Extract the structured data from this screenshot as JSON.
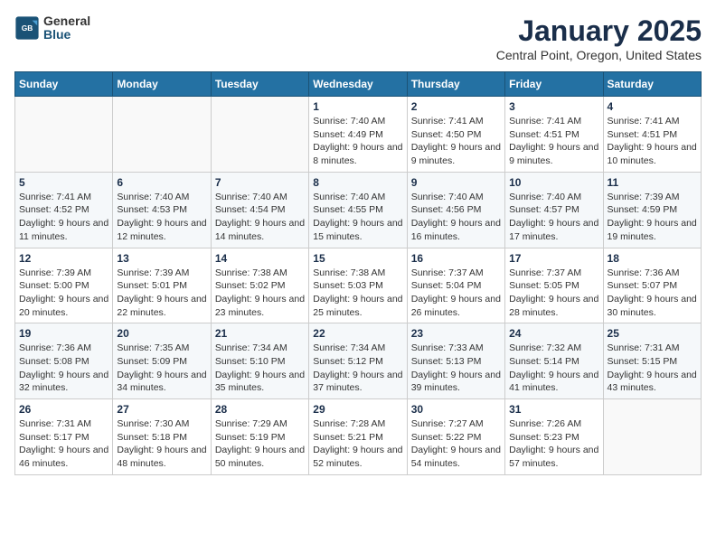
{
  "logo": {
    "general": "General",
    "blue": "Blue"
  },
  "title": "January 2025",
  "subtitle": "Central Point, Oregon, United States",
  "days_header": [
    "Sunday",
    "Monday",
    "Tuesday",
    "Wednesday",
    "Thursday",
    "Friday",
    "Saturday"
  ],
  "weeks": [
    [
      {
        "day": "",
        "info": ""
      },
      {
        "day": "",
        "info": ""
      },
      {
        "day": "",
        "info": ""
      },
      {
        "day": "1",
        "info": "Sunrise: 7:40 AM\nSunset: 4:49 PM\nDaylight: 9 hours and 8 minutes."
      },
      {
        "day": "2",
        "info": "Sunrise: 7:41 AM\nSunset: 4:50 PM\nDaylight: 9 hours and 9 minutes."
      },
      {
        "day": "3",
        "info": "Sunrise: 7:41 AM\nSunset: 4:51 PM\nDaylight: 9 hours and 9 minutes."
      },
      {
        "day": "4",
        "info": "Sunrise: 7:41 AM\nSunset: 4:51 PM\nDaylight: 9 hours and 10 minutes."
      }
    ],
    [
      {
        "day": "5",
        "info": "Sunrise: 7:41 AM\nSunset: 4:52 PM\nDaylight: 9 hours and 11 minutes."
      },
      {
        "day": "6",
        "info": "Sunrise: 7:40 AM\nSunset: 4:53 PM\nDaylight: 9 hours and 12 minutes."
      },
      {
        "day": "7",
        "info": "Sunrise: 7:40 AM\nSunset: 4:54 PM\nDaylight: 9 hours and 14 minutes."
      },
      {
        "day": "8",
        "info": "Sunrise: 7:40 AM\nSunset: 4:55 PM\nDaylight: 9 hours and 15 minutes."
      },
      {
        "day": "9",
        "info": "Sunrise: 7:40 AM\nSunset: 4:56 PM\nDaylight: 9 hours and 16 minutes."
      },
      {
        "day": "10",
        "info": "Sunrise: 7:40 AM\nSunset: 4:57 PM\nDaylight: 9 hours and 17 minutes."
      },
      {
        "day": "11",
        "info": "Sunrise: 7:39 AM\nSunset: 4:59 PM\nDaylight: 9 hours and 19 minutes."
      }
    ],
    [
      {
        "day": "12",
        "info": "Sunrise: 7:39 AM\nSunset: 5:00 PM\nDaylight: 9 hours and 20 minutes."
      },
      {
        "day": "13",
        "info": "Sunrise: 7:39 AM\nSunset: 5:01 PM\nDaylight: 9 hours and 22 minutes."
      },
      {
        "day": "14",
        "info": "Sunrise: 7:38 AM\nSunset: 5:02 PM\nDaylight: 9 hours and 23 minutes."
      },
      {
        "day": "15",
        "info": "Sunrise: 7:38 AM\nSunset: 5:03 PM\nDaylight: 9 hours and 25 minutes."
      },
      {
        "day": "16",
        "info": "Sunrise: 7:37 AM\nSunset: 5:04 PM\nDaylight: 9 hours and 26 minutes."
      },
      {
        "day": "17",
        "info": "Sunrise: 7:37 AM\nSunset: 5:05 PM\nDaylight: 9 hours and 28 minutes."
      },
      {
        "day": "18",
        "info": "Sunrise: 7:36 AM\nSunset: 5:07 PM\nDaylight: 9 hours and 30 minutes."
      }
    ],
    [
      {
        "day": "19",
        "info": "Sunrise: 7:36 AM\nSunset: 5:08 PM\nDaylight: 9 hours and 32 minutes."
      },
      {
        "day": "20",
        "info": "Sunrise: 7:35 AM\nSunset: 5:09 PM\nDaylight: 9 hours and 34 minutes."
      },
      {
        "day": "21",
        "info": "Sunrise: 7:34 AM\nSunset: 5:10 PM\nDaylight: 9 hours and 35 minutes."
      },
      {
        "day": "22",
        "info": "Sunrise: 7:34 AM\nSunset: 5:12 PM\nDaylight: 9 hours and 37 minutes."
      },
      {
        "day": "23",
        "info": "Sunrise: 7:33 AM\nSunset: 5:13 PM\nDaylight: 9 hours and 39 minutes."
      },
      {
        "day": "24",
        "info": "Sunrise: 7:32 AM\nSunset: 5:14 PM\nDaylight: 9 hours and 41 minutes."
      },
      {
        "day": "25",
        "info": "Sunrise: 7:31 AM\nSunset: 5:15 PM\nDaylight: 9 hours and 43 minutes."
      }
    ],
    [
      {
        "day": "26",
        "info": "Sunrise: 7:31 AM\nSunset: 5:17 PM\nDaylight: 9 hours and 46 minutes."
      },
      {
        "day": "27",
        "info": "Sunrise: 7:30 AM\nSunset: 5:18 PM\nDaylight: 9 hours and 48 minutes."
      },
      {
        "day": "28",
        "info": "Sunrise: 7:29 AM\nSunset: 5:19 PM\nDaylight: 9 hours and 50 minutes."
      },
      {
        "day": "29",
        "info": "Sunrise: 7:28 AM\nSunset: 5:21 PM\nDaylight: 9 hours and 52 minutes."
      },
      {
        "day": "30",
        "info": "Sunrise: 7:27 AM\nSunset: 5:22 PM\nDaylight: 9 hours and 54 minutes."
      },
      {
        "day": "31",
        "info": "Sunrise: 7:26 AM\nSunset: 5:23 PM\nDaylight: 9 hours and 57 minutes."
      },
      {
        "day": "",
        "info": ""
      }
    ]
  ]
}
